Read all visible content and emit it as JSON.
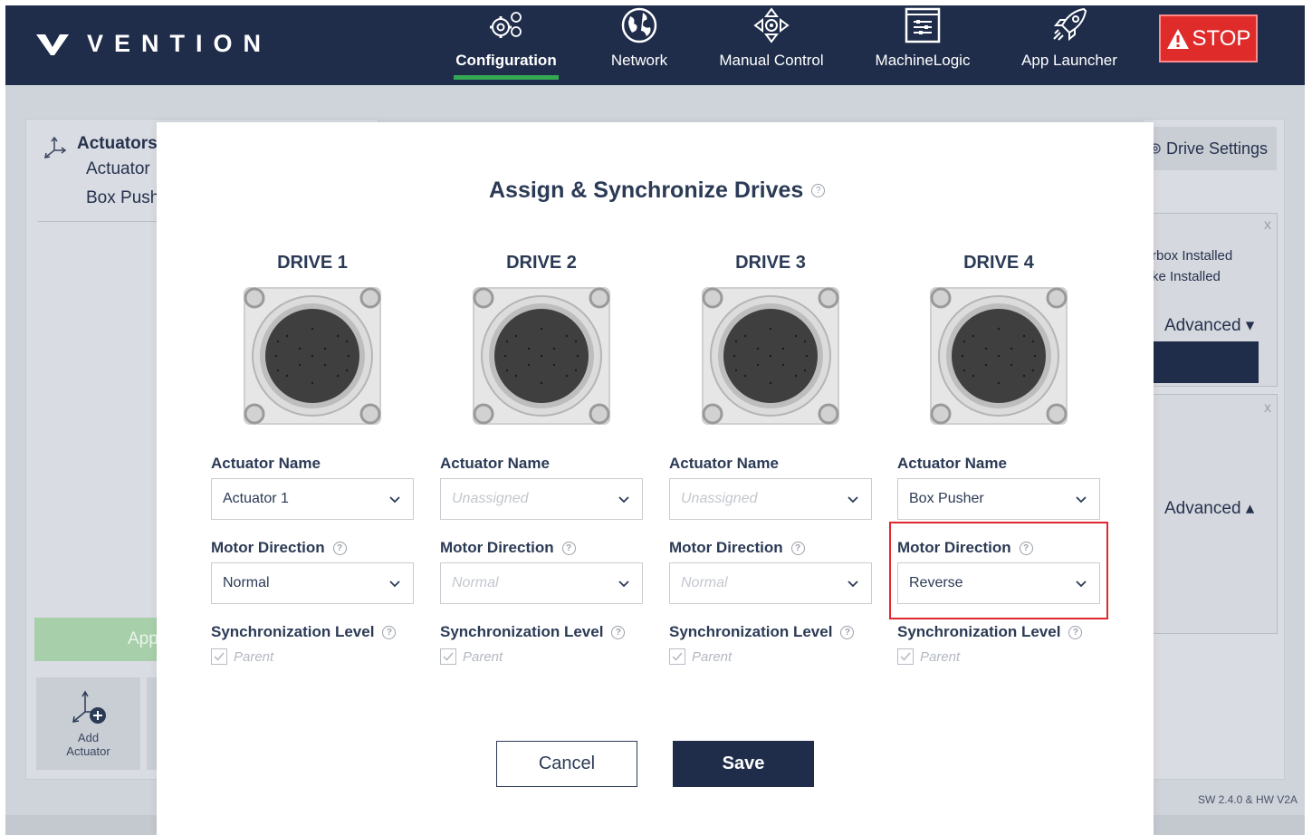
{
  "app": {
    "logo_text": "VENTION",
    "nav": [
      {
        "label": "Configuration",
        "icon": "gears-icon",
        "active": true
      },
      {
        "label": "Network",
        "icon": "globe-icon"
      },
      {
        "label": "Manual Control",
        "icon": "joystick-icon"
      },
      {
        "label": "MachineLogic",
        "icon": "logic-icon"
      },
      {
        "label": "App Launcher",
        "icon": "rocket-icon"
      }
    ],
    "stop_label": "STOP",
    "accent_color": "#34a853",
    "stop_color": "#e02b2b"
  },
  "background": {
    "tree_title": "Actuators",
    "tree_items": [
      "Actuator",
      "Box Push"
    ],
    "apply_label": "App",
    "add_tile_label_1": "Add",
    "add_tile_label_2": "Actuator",
    "drive_settings_label": "Drive Settings",
    "card1_line1": "rbox Installed",
    "card1_line2": "ke Installed",
    "advanced_down": "Advanced ▾",
    "advanced_up": "Advanced ▴",
    "close": "x",
    "version": "SW 2.4.0 & HW V2A"
  },
  "modal": {
    "title": "Assign & Synchronize Drives",
    "help_glyph": "?",
    "actuator_name_label": "Actuator Name",
    "motor_direction_label": "Motor Direction",
    "sync_level_label": "Synchronization Level",
    "parent_label": "Parent",
    "drives": [
      {
        "title": "DRIVE 1",
        "actuator": "Actuator 1",
        "actuator_assigned": true,
        "direction": "Normal",
        "direction_enabled": true
      },
      {
        "title": "DRIVE 2",
        "actuator": "Unassigned",
        "actuator_assigned": false,
        "direction": "Normal",
        "direction_enabled": false
      },
      {
        "title": "DRIVE 3",
        "actuator": "Unassigned",
        "actuator_assigned": false,
        "direction": "Normal",
        "direction_enabled": false
      },
      {
        "title": "DRIVE 4",
        "actuator": "Box Pusher",
        "actuator_assigned": true,
        "direction": "Reverse",
        "direction_enabled": true
      }
    ],
    "cancel_label": "Cancel",
    "save_label": "Save"
  }
}
